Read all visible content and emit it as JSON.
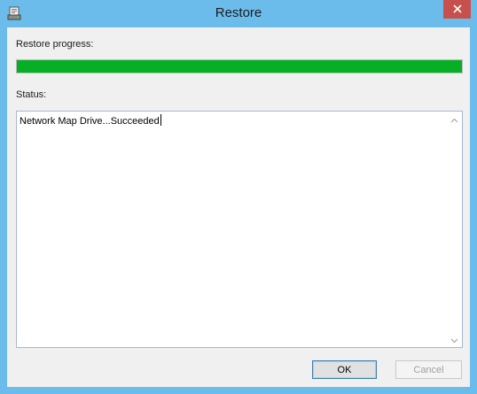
{
  "window": {
    "title": "Restore",
    "app_icon": "restore-app-icon",
    "close_icon": "close-icon"
  },
  "progress": {
    "label": "Restore progress:",
    "percent": 100,
    "fill_color": "#06b025"
  },
  "status": {
    "label": "Status:",
    "text": "Network Map Drive...Succeeded"
  },
  "buttons": {
    "ok_label": "OK",
    "cancel_label": "Cancel",
    "cancel_enabled": false
  },
  "colors": {
    "frame": "#6bbcea",
    "close_button": "#c7504c",
    "dialog_background": "#f0f0f0"
  }
}
